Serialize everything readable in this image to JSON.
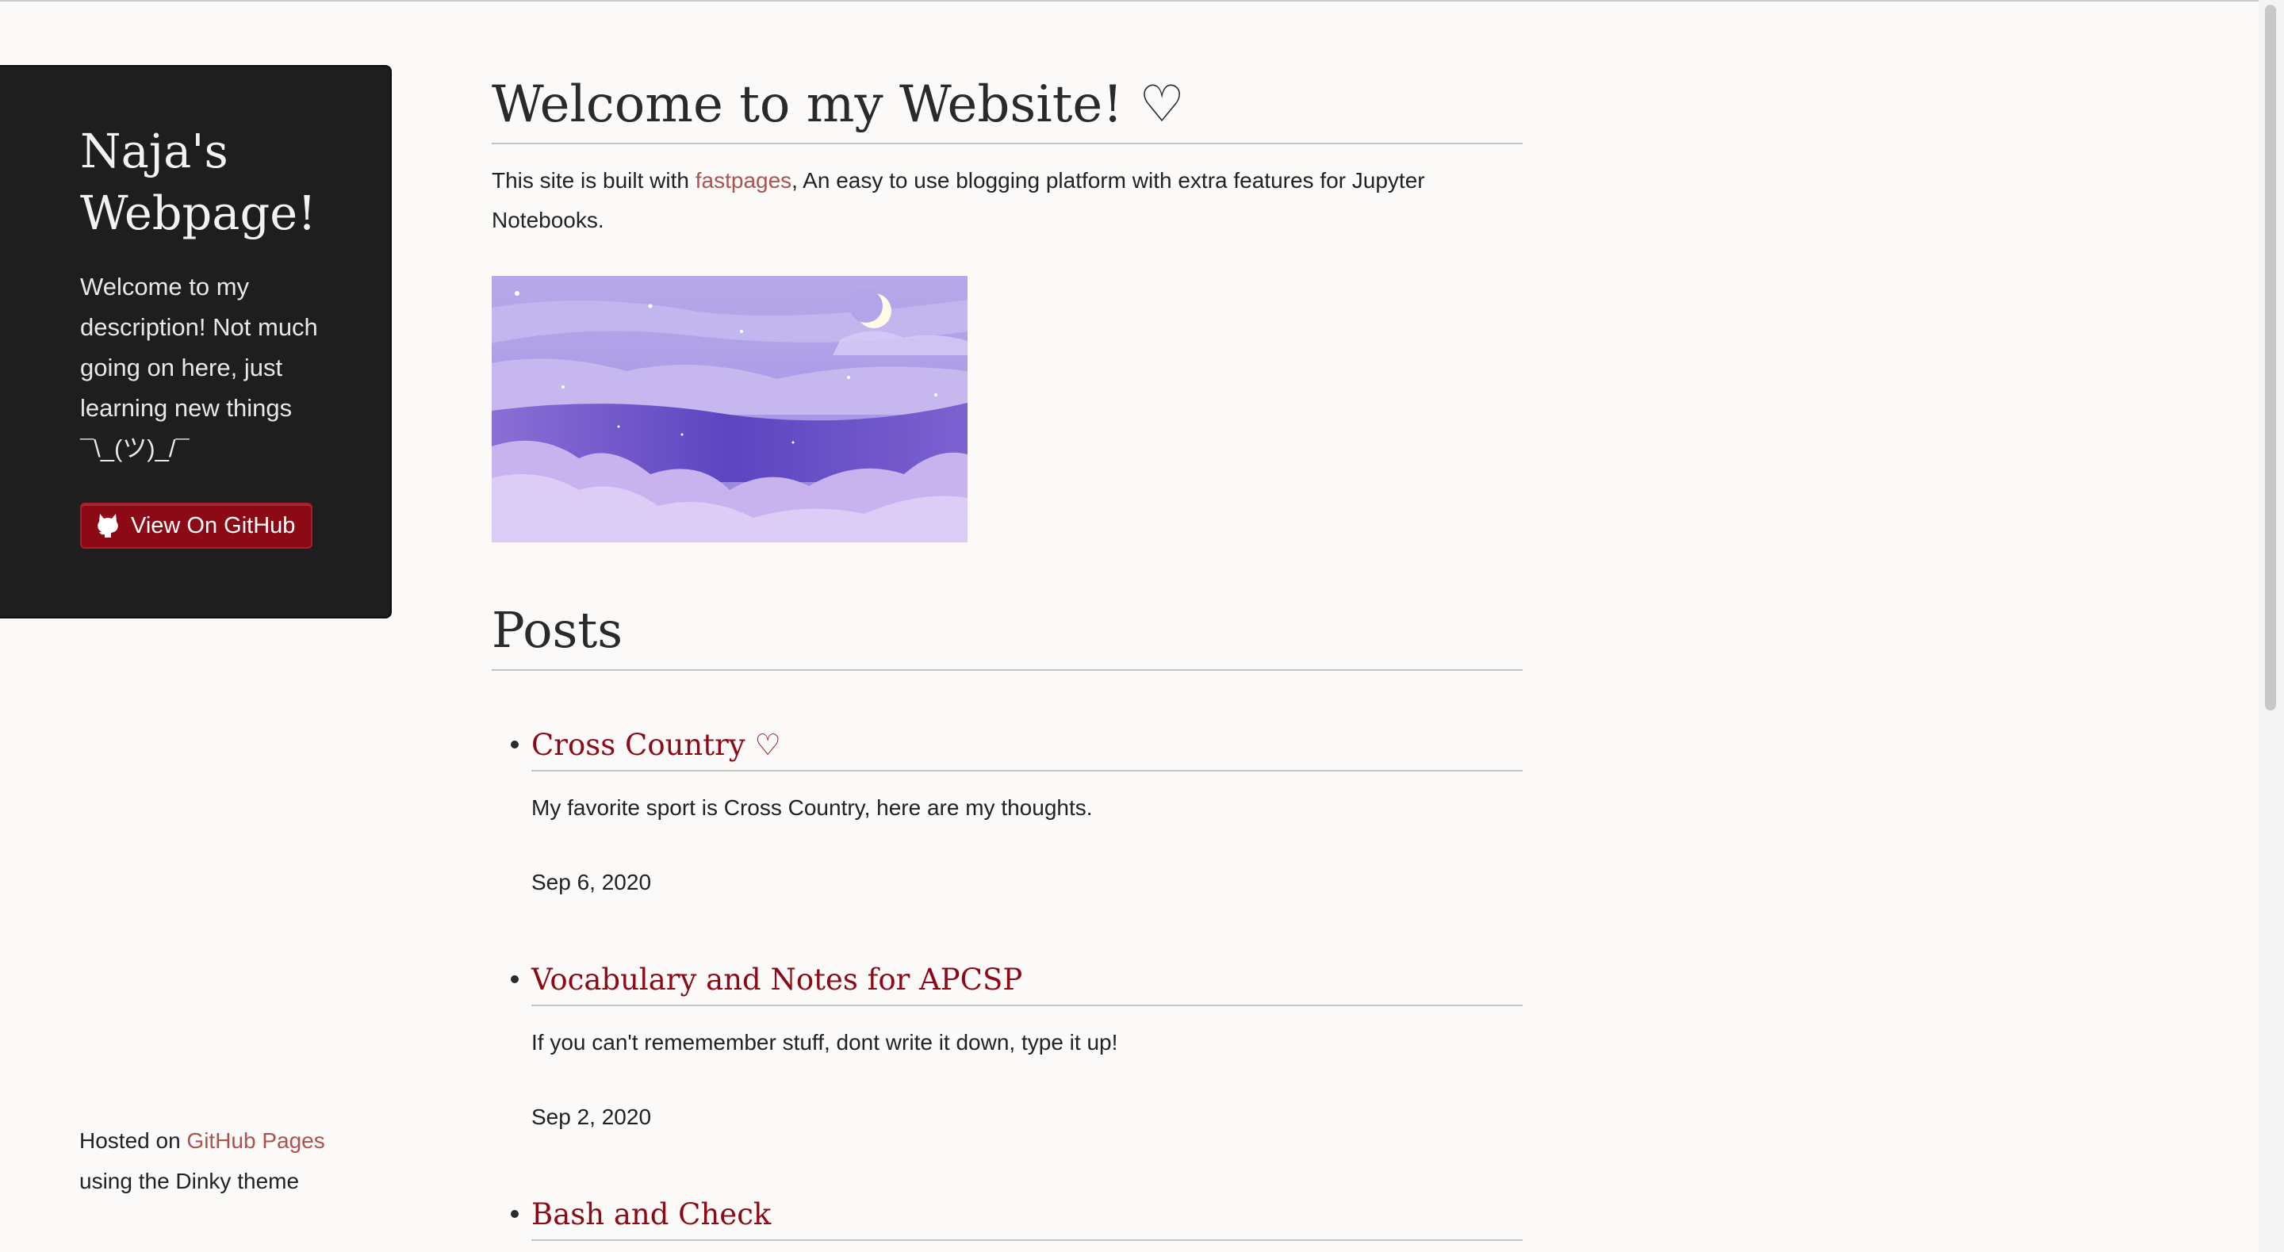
{
  "sidebar": {
    "title": "Naja's Webpage!",
    "description": "Welcome to my description! Not much going on here, just learning new things ¯\\_(ツ)_/¯",
    "github_button": "View On GitHub",
    "github_icon": "github-octocat-icon",
    "button_color": "#8b0a16"
  },
  "main": {
    "title": "Welcome to my Website! ♡",
    "intro": {
      "before": "This site is built with ",
      "link": "fastpages",
      "after": ", An easy to use blogging platform with extra features for Jupyter Notebooks."
    },
    "hero_image": "purple-night-sky-clouds-moon-image",
    "posts_heading": "Posts",
    "posts": [
      {
        "title": "Cross Country ♡",
        "description": "My favorite sport is Cross Country, here are my thoughts.",
        "date": "Sep 6, 2020"
      },
      {
        "title": "Vocabulary and Notes for APCSP",
        "description": "If you can't rememember stuff, dont write it down, type it up!",
        "date": "Sep 2, 2020"
      },
      {
        "title": "Bash and Check",
        "description": "",
        "date": ""
      }
    ]
  },
  "footer": {
    "hosted_prefix": "Hosted on ",
    "hosted_link": "GitHub Pages",
    "theme_text": "using the Dinky theme"
  },
  "colors": {
    "link": "#a9554d",
    "post_title": "#8b0a16",
    "sidebar_bg": "#1e1e1e",
    "page_bg": "#fbfaf8"
  }
}
